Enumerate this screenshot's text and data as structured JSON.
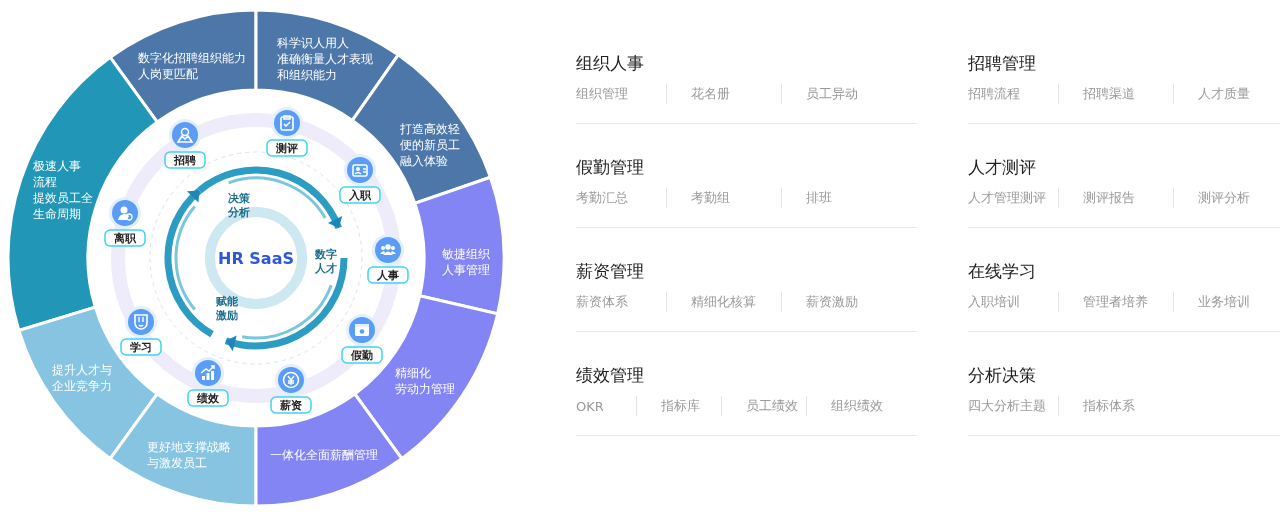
{
  "wheel": {
    "center_label": "HR SaaS",
    "inner_labels": [
      {
        "lines": [
          "决策",
          "分析"
        ]
      },
      {
        "lines": [
          "数字",
          "人才"
        ]
      },
      {
        "lines": [
          "赋能",
          "激励"
        ]
      }
    ],
    "modules": [
      {
        "label": "招聘"
      },
      {
        "label": "测评"
      },
      {
        "label": "入职"
      },
      {
        "label": "人事"
      },
      {
        "label": "假勤"
      },
      {
        "label": "薪资"
      },
      {
        "label": "绩效"
      },
      {
        "label": "学习"
      },
      {
        "label": "离职"
      }
    ],
    "segments": [
      {
        "lines": [
          "数字化招聘组织能力",
          "人岗更匹配"
        ],
        "color": "#4c77a8"
      },
      {
        "lines": [
          "科学识人用人",
          "准确衡量人才表现",
          "和组织能力"
        ],
        "color": "#4c77a8"
      },
      {
        "lines": [
          "打造高效轻",
          "便的新员工",
          "融入体验"
        ],
        "color": "#4c77a8"
      },
      {
        "lines": [
          "极速人事",
          "流程",
          "提效员工全",
          "生命周期"
        ],
        "color": "#2196b6"
      },
      {
        "lines": [
          "敏捷组织",
          "人事管理"
        ],
        "color": "#8385f5"
      },
      {
        "lines": [
          "提升人才与",
          "企业竞争力"
        ],
        "color": "#86c4e2"
      },
      {
        "lines": [
          "精细化",
          "劳动力管理"
        ],
        "color": "#8385f5"
      },
      {
        "lines": [
          "更好地支撑战略",
          "与激发员工"
        ],
        "color": "#86c4e2"
      },
      {
        "lines": [
          "一体化全面薪酬管理"
        ],
        "color": "#8385f5"
      }
    ]
  },
  "categories": [
    {
      "title": "组织人事",
      "items": [
        "组织管理",
        "花名册",
        "员工异动"
      ]
    },
    {
      "title": "招聘管理",
      "items": [
        "招聘流程",
        "招聘渠道",
        "人才质量"
      ]
    },
    {
      "title": "假勤管理",
      "items": [
        "考勤汇总",
        "考勤组",
        "排班"
      ]
    },
    {
      "title": "人才测评",
      "items": [
        "人才管理测评",
        "测评报告",
        "测评分析"
      ]
    },
    {
      "title": "薪资管理",
      "items": [
        "薪资体系",
        "精细化核算",
        "薪资激励"
      ]
    },
    {
      "title": "在线学习",
      "items": [
        "入职培训",
        "管理者培养",
        "业务培训"
      ]
    },
    {
      "title": "绩效管理",
      "items": [
        "OKR",
        "指标库",
        "员工绩效",
        "组织绩效"
      ]
    },
    {
      "title": "分析决策",
      "items": [
        "四大分析主题",
        "指标体系"
      ]
    }
  ]
}
